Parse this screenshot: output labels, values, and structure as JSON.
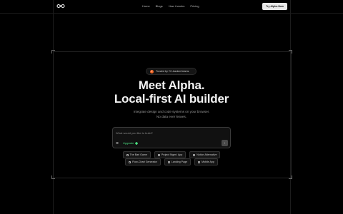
{
  "nav": {
    "links": [
      "Home",
      "Blogs",
      "How it works",
      "Pricing"
    ],
    "cta_label": "Try Alpha Now"
  },
  "badge": {
    "icon_letter": "Y",
    "text": "Trusted by YC-backed teams"
  },
  "hero": {
    "title_line1": "Meet Alpha.",
    "title_line2": "Local-first AI builder",
    "subtitle_line1": "Integrate design and code systems on your browser.",
    "subtitle_line2": "No data ever leaves."
  },
  "prompt": {
    "placeholder": "What would you like to build?",
    "command_symbol": "⌘",
    "upgrade_label": "Upgrade",
    "send_symbol": "↑"
  },
  "chips_row1": [
    "The Bari Game",
    "Project Mgmt. App",
    "Notion Alternative"
  ],
  "chips_row2": [
    "Flow-Chart Generator",
    "Landing Page",
    "Mobile App"
  ],
  "colors": {
    "accent_green": "#4ade80",
    "yc_orange": "#f26625",
    "cta_bg": "#e8e8e8"
  }
}
